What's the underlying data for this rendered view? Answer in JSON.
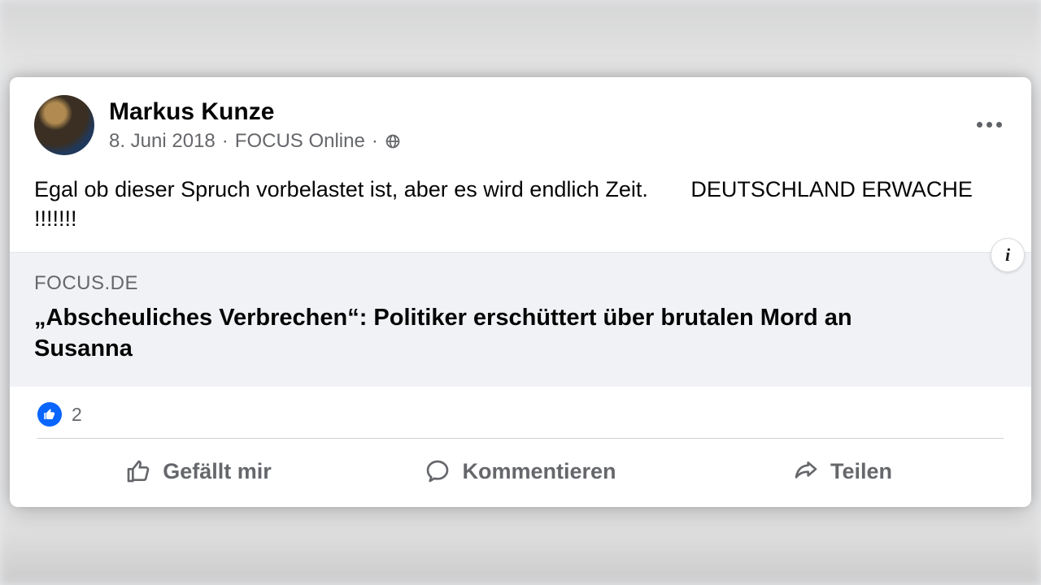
{
  "post": {
    "author_name": "Markus Kunze",
    "date": "8. Juni 2018",
    "source": "FOCUS Online",
    "text": "Egal ob dieser Spruch vorbelastet ist, aber es wird endlich Zeit.       DEUTSCHLAND ERWACHE !!!!!!!",
    "link": {
      "domain": "FOCUS.DE",
      "title": "„Abscheuliches Verbrechen“: Politiker erschüttert über brutalen Mord an Susanna"
    },
    "reactions": {
      "count": "2"
    },
    "actions": {
      "like": "Gefällt mir",
      "comment": "Kommentieren",
      "share": "Teilen"
    }
  }
}
